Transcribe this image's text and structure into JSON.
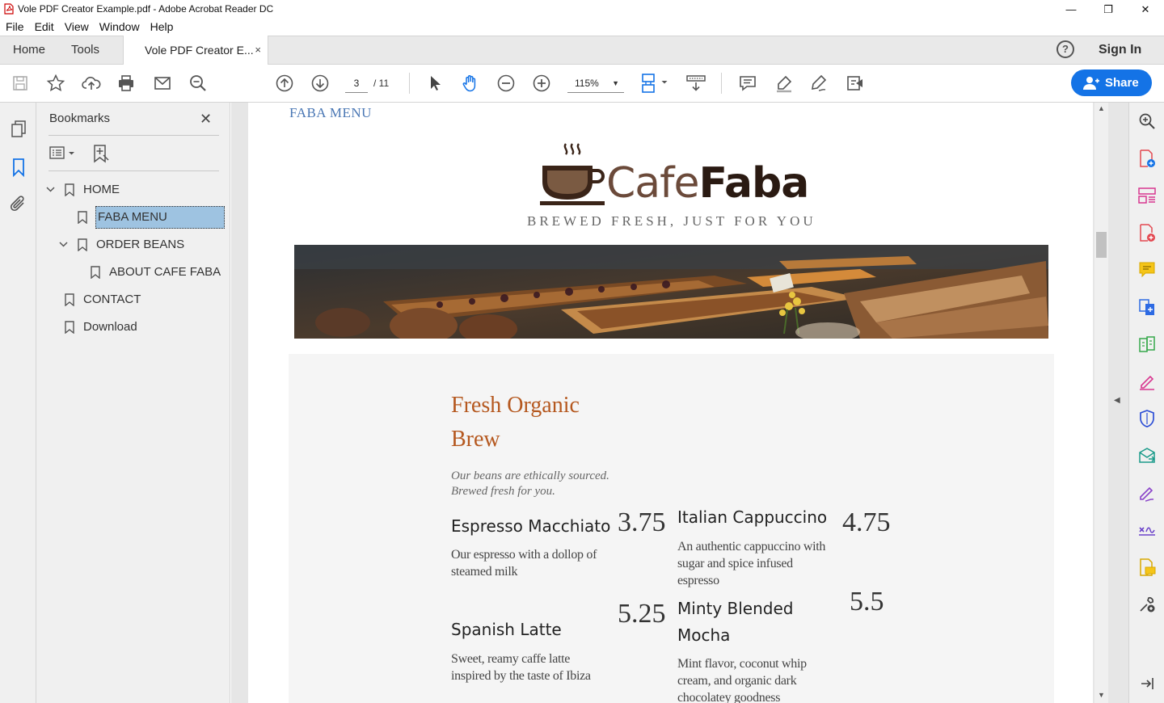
{
  "window": {
    "title": "Vole PDF Creator Example.pdf - Adobe Acrobat Reader DC",
    "minimize": "—",
    "restore": "❐",
    "close": "✕"
  },
  "menu": [
    "File",
    "Edit",
    "View",
    "Window",
    "Help"
  ],
  "tabs": {
    "home": "Home",
    "tools": "Tools",
    "document": "Vole PDF Creator E...",
    "close": "×",
    "help_icon": "?",
    "sign_in": "Sign In"
  },
  "toolbar": {
    "page_current": "3",
    "page_total": "/ 11",
    "zoom": "115%",
    "share": "Share"
  },
  "bookmarks": {
    "title": "Bookmarks",
    "close": "✕",
    "items": [
      {
        "label": "HOME"
      },
      {
        "label": "FABA MENU"
      },
      {
        "label": "ORDER BEANS"
      },
      {
        "label": "ABOUT CAFE FABA"
      },
      {
        "label": "CONTACT"
      },
      {
        "label": "Download"
      }
    ]
  },
  "page": {
    "header": "FABA MENU",
    "logo_light": "Cafe",
    "logo_bold": "Faba",
    "tagline": "BREWED FRESH, JUST FOR YOU",
    "section_title_line1": "Fresh Organic",
    "section_title_line2": "Brew",
    "section_subtitle": "Our beans are ethically sourced. Brewed fresh for you.",
    "items": [
      {
        "name": "Espresso Macchiato",
        "price": "3.75",
        "desc": "Our espresso with a dollop of steamed milk"
      },
      {
        "name": "Italian Cappuccino",
        "price": "4.75",
        "desc": "An authentic cappuccino with sugar and spice infused espresso"
      },
      {
        "name": "Spanish Latte",
        "price": "5.25",
        "desc": "Sweet, reamy caffe latte inspired by the taste of Ibiza"
      },
      {
        "name": "Minty Blended Mocha",
        "price": "5.5",
        "desc": "Mint flavor, coconut whip cream, and organic dark chocolatey goodness"
      }
    ]
  },
  "colors": {
    "accent": "#1473e6",
    "heading_orange": "#b5581f",
    "header_blue": "#4a77b4",
    "selection": "#9ec3e1"
  }
}
